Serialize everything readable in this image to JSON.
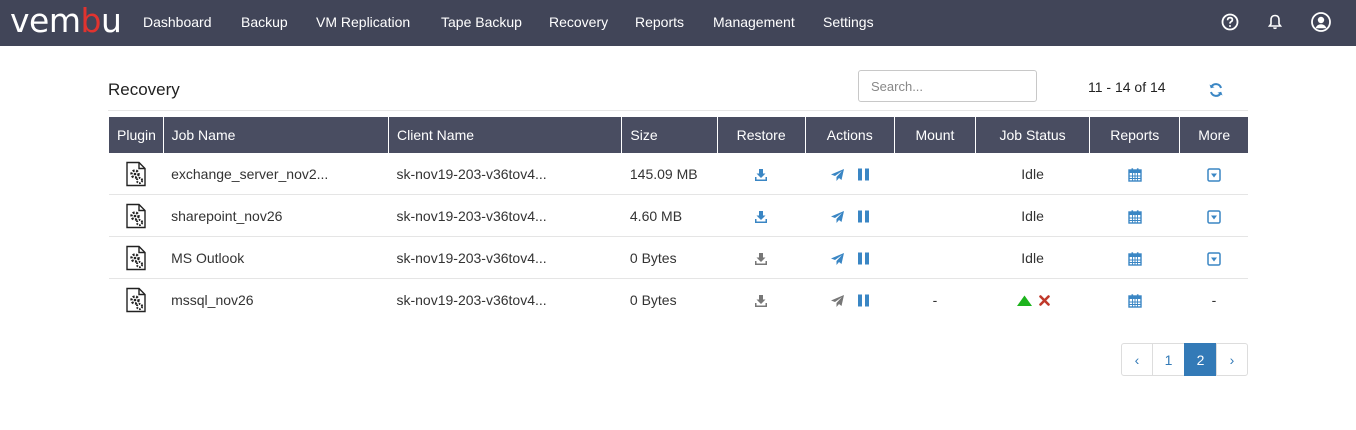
{
  "header": {
    "logo_main": "vem",
    "logo_accent": "b",
    "logo_tail": "u",
    "nav": [
      "Dashboard",
      "Backup",
      "VM Replication",
      "Tape Backup",
      "Recovery",
      "Reports",
      "Management",
      "Settings"
    ]
  },
  "page": {
    "title": "Recovery",
    "search_placeholder": "Search...",
    "page_info": "11 - 14 of 14"
  },
  "table": {
    "columns": [
      "Plugin",
      "Job Name",
      "Client Name",
      "Size",
      "Restore",
      "Actions",
      "Mount",
      "Job Status",
      "Reports",
      "More"
    ],
    "rows": [
      {
        "job": "exchange_server_nov2...",
        "client": "sk-nov19-203-v36tov4...",
        "size": "145.09 MB",
        "restore_enabled": true,
        "send_enabled": true,
        "mount": "",
        "status": "Idle",
        "status_icons": false,
        "more": "dropdown"
      },
      {
        "job": "sharepoint_nov26",
        "client": "sk-nov19-203-v36tov4...",
        "size": "4.60 MB",
        "restore_enabled": true,
        "send_enabled": true,
        "mount": "",
        "status": "Idle",
        "status_icons": false,
        "more": "dropdown"
      },
      {
        "job": "MS Outlook",
        "client": "sk-nov19-203-v36tov4...",
        "size": "0 Bytes",
        "restore_enabled": false,
        "send_enabled": true,
        "mount": "",
        "status": "Idle",
        "status_icons": false,
        "more": "dropdown"
      },
      {
        "job": "mssql_nov26",
        "client": "sk-nov19-203-v36tov4...",
        "size": "0 Bytes",
        "restore_enabled": false,
        "send_enabled": false,
        "mount": "-",
        "status": "",
        "status_icons": true,
        "more": "-"
      }
    ]
  },
  "pagination": {
    "prev": "‹",
    "pages": [
      "1",
      "2"
    ],
    "current": "2",
    "next": "›"
  },
  "colors": {
    "header_bg": "#414558",
    "table_header_bg": "#494d61",
    "accent_blue": "#337ab7",
    "icon_blue": "#3a86c4",
    "icon_gray": "#777777",
    "logo_red": "#e0332f",
    "success_green": "#1db31d",
    "error_red": "#c0392b"
  }
}
